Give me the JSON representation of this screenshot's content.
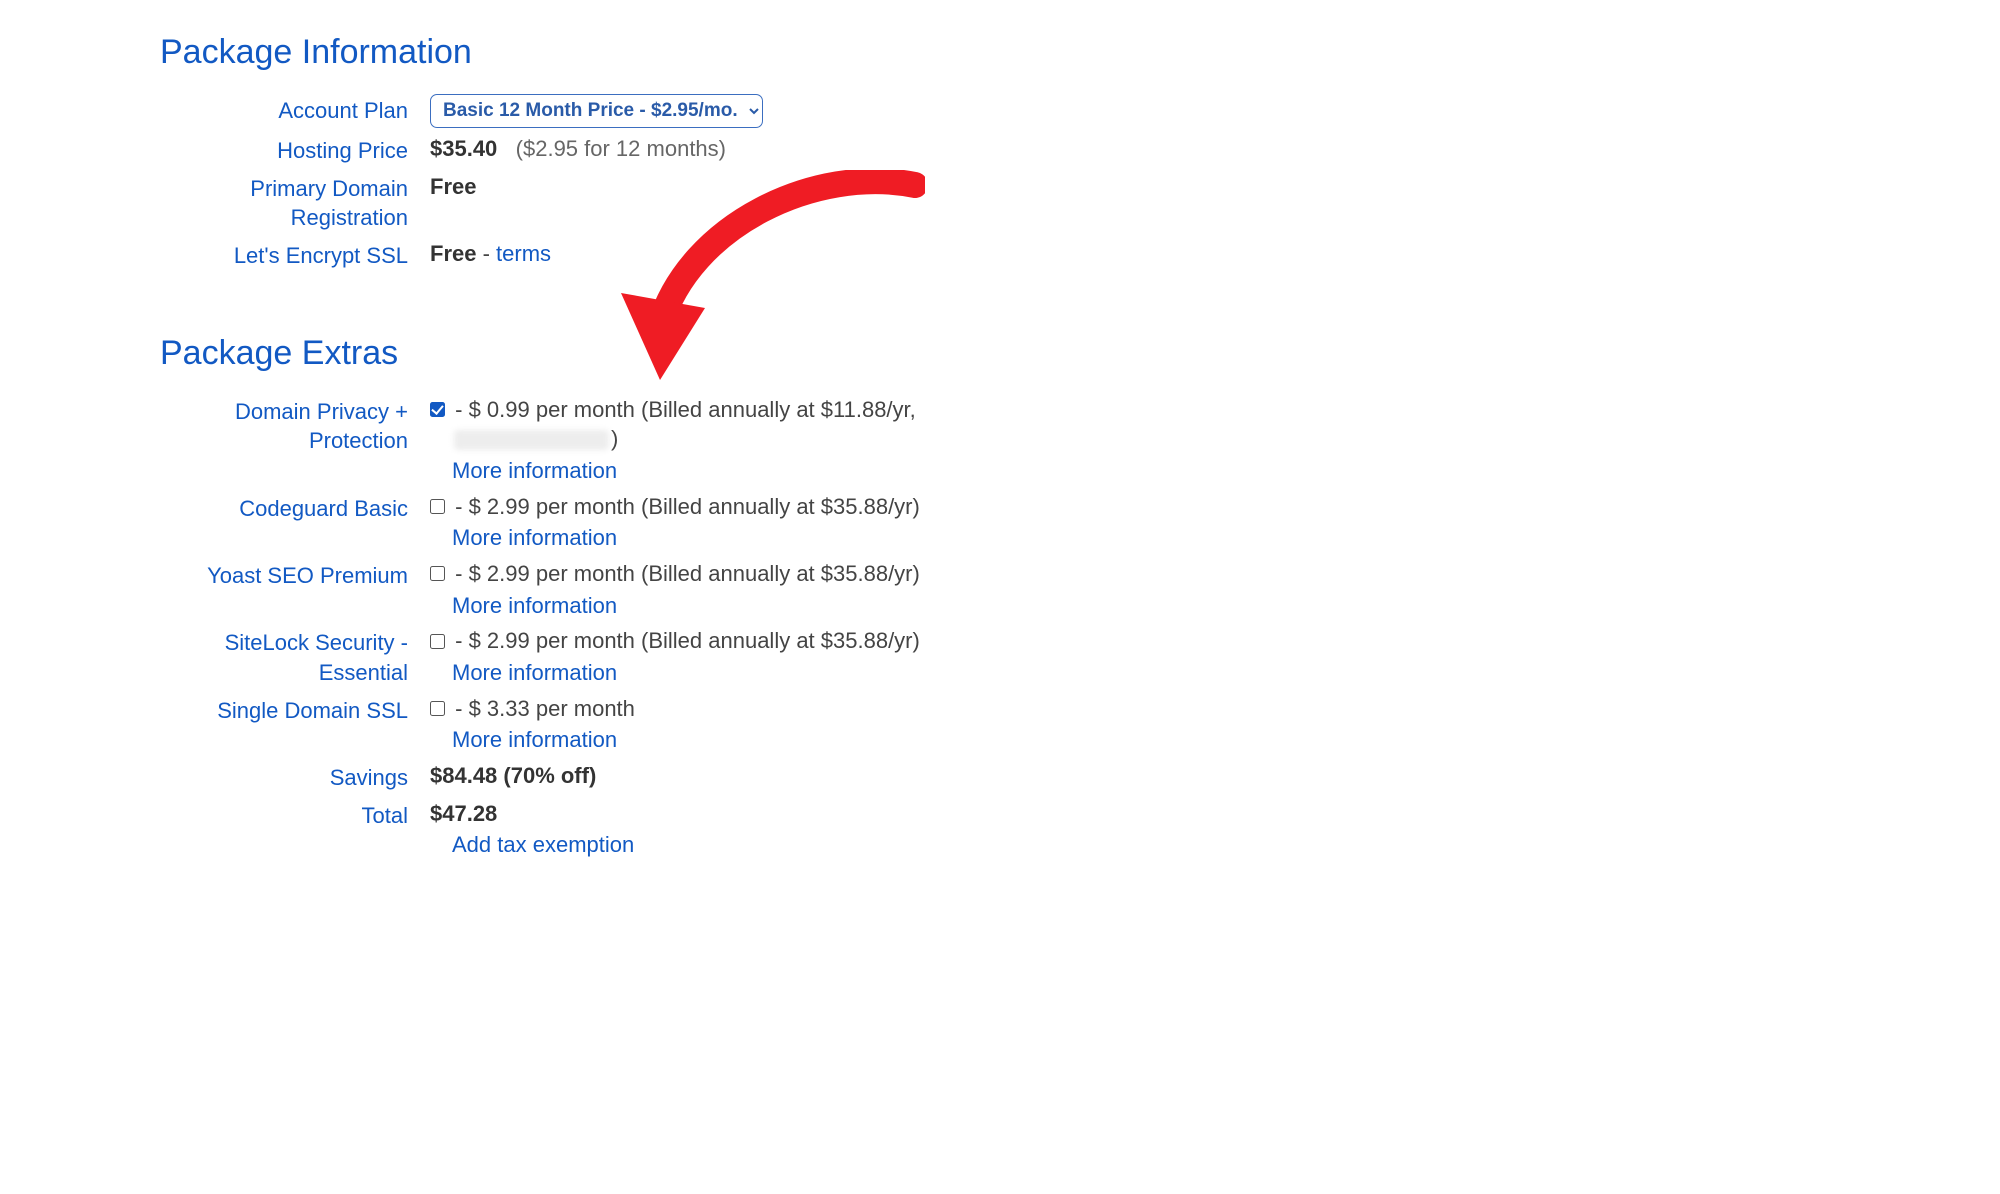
{
  "package_info": {
    "title": "Package Information",
    "fields": {
      "account_plan_label": "Account Plan",
      "account_plan_value": "Basic 12 Month Price - $2.95/mo.",
      "hosting_price_label": "Hosting Price",
      "hosting_price_value": "$35.40",
      "hosting_price_detail": "($2.95 for 12 months)",
      "primary_domain_label": "Primary Domain Registration",
      "primary_domain_value": "Free",
      "ssl_label": "Let's Encrypt SSL",
      "ssl_value": "Free",
      "ssl_dash": " - ",
      "ssl_terms": "terms"
    }
  },
  "package_extras": {
    "title": "Package Extras",
    "items": [
      {
        "label": "Domain Privacy + Protection",
        "checked": true,
        "price_text": " - $ 0.99 per month (Billed annually at $11.88/yr,",
        "tail": ")",
        "has_blur": true,
        "more_info": "More information"
      },
      {
        "label": "Codeguard Basic",
        "checked": false,
        "price_text": " - $ 2.99 per month (Billed annually at $35.88/yr)",
        "more_info": "More information"
      },
      {
        "label": "Yoast SEO Premium",
        "checked": false,
        "price_text": " - $ 2.99 per month (Billed annually at $35.88/yr)",
        "more_info": "More information"
      },
      {
        "label": "SiteLock Security - Essential",
        "checked": false,
        "price_text": " - $ 2.99 per month (Billed annually at $35.88/yr)",
        "more_info": "More information"
      },
      {
        "label": "Single Domain SSL",
        "checked": false,
        "price_text": " - $ 3.33 per month",
        "more_info": "More information"
      }
    ],
    "savings_label": "Savings",
    "savings_value": "$84.48 (70% off)",
    "total_label": "Total",
    "total_value": "$47.28",
    "tax_link": "Add tax exemption"
  }
}
